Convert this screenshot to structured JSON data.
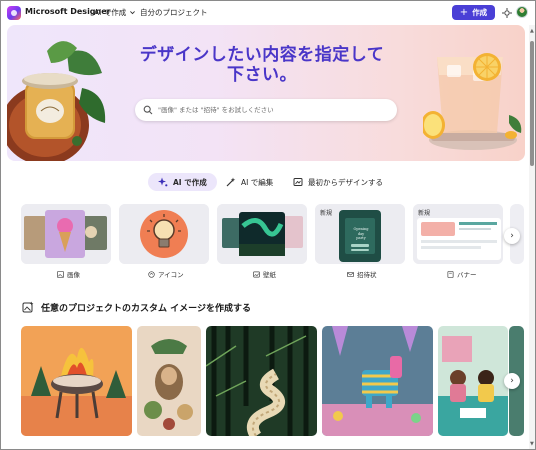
{
  "app": {
    "brand": "Microsoft Designer",
    "nav_create_with_ai": "AI で作成",
    "nav_my_projects": "自分のプロジェクト",
    "create_button": "作成"
  },
  "hero": {
    "title_line1": "デザインしたい内容を指定して",
    "title_line2": "下さい。",
    "search_placeholder": "\"画像\" または \"招待\" をお試しください"
  },
  "modes": [
    {
      "label": "AI で作成",
      "icon": "sparkle-icon",
      "active": true
    },
    {
      "label": "AI で編集",
      "icon": "magic-wand-icon",
      "active": false
    },
    {
      "label": "最初からデザインする",
      "icon": "canvas-icon",
      "active": false
    }
  ],
  "categories": [
    {
      "label": "画像",
      "icon": "image-icon",
      "badge": ""
    },
    {
      "label": "アイコン",
      "icon": "icon-shape-icon",
      "badge": ""
    },
    {
      "label": "壁紙",
      "icon": "wallpaper-icon",
      "badge": ""
    },
    {
      "label": "招待状",
      "icon": "invitation-icon",
      "badge": "新規"
    },
    {
      "label": "バナー",
      "icon": "banner-icon",
      "badge": "新規"
    }
  ],
  "invite_card_text": "Opening day party",
  "section": {
    "title": "任意のプロジェクトのカスタム イメージを作成する"
  },
  "colors": {
    "accent": "#4a3fd6",
    "hero_title": "#4a36c8",
    "active_tab_bg": "#ece6fb"
  }
}
